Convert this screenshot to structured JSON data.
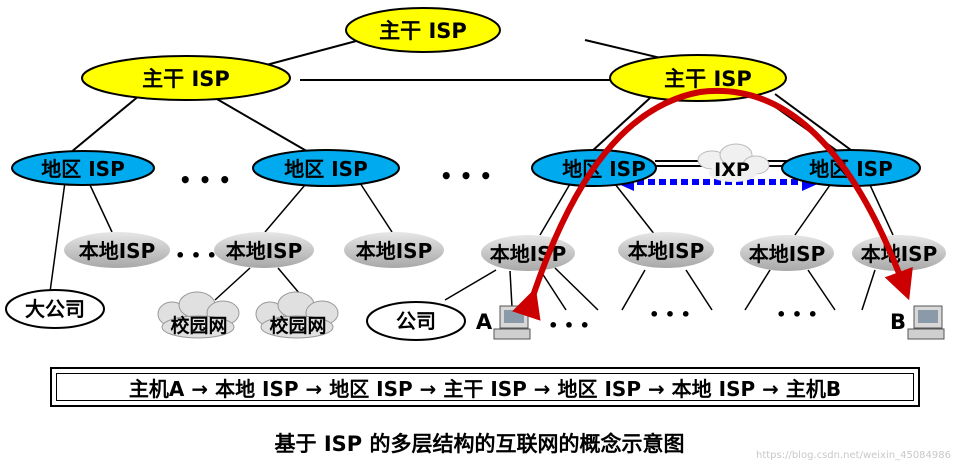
{
  "labels": {
    "backbone_isp": "主干 ISP",
    "regional_isp": "地区 ISP",
    "local_isp": "本地ISP",
    "ixp": "IXP",
    "ellipsis": "• • •",
    "big_company": "大公司",
    "campus_net": "校园网",
    "company": "公司",
    "host_a": "A",
    "host_b": "B"
  },
  "path_text": "主机A → 本地 ISP → 地区 ISP → 主干 ISP → 地区 ISP → 本地 ISP → 主机B",
  "caption": "基于 ISP 的多层结构的互联网的概念示意图",
  "watermark": "https://blog.csdn.net/weixin_45084986",
  "colors": {
    "backbone_fill": "#ffff00",
    "regional_fill": "#00aaee",
    "local_fill": "#c0c0c0",
    "route_arrow": "#cc0000",
    "ixp_link": "#0000ff"
  }
}
